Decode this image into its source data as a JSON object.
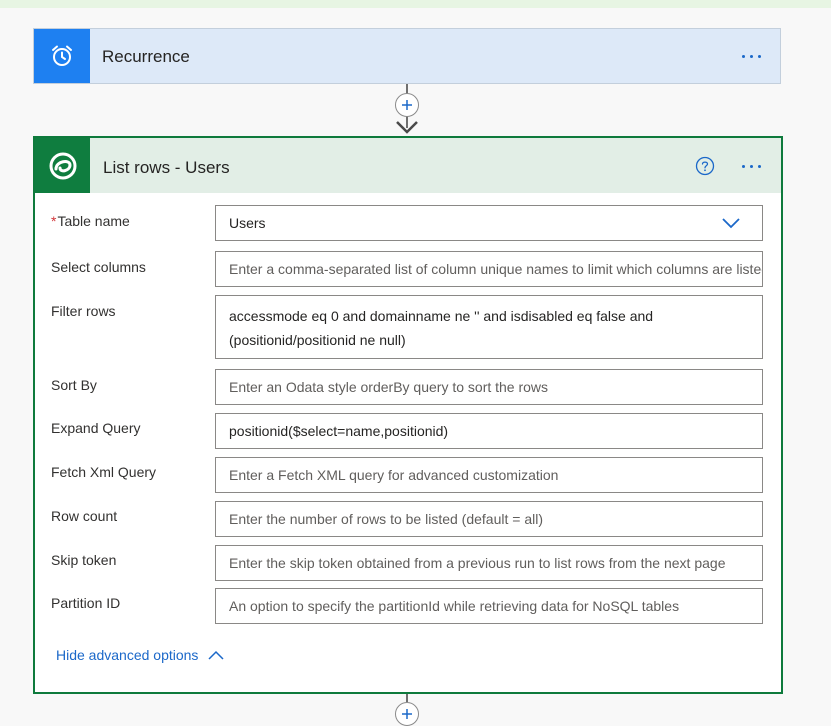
{
  "colors": {
    "recurrence_accent": "#1e80f1",
    "dataverse_accent": "#0f7d3f",
    "link": "#1b68c9",
    "required_star": "#d13438"
  },
  "recurrence": {
    "title": "Recurrence",
    "icon": "alarm-clock-icon",
    "menu_icon": "more-options-icon"
  },
  "connector": {
    "add_icon": "plus-icon",
    "arrow_icon": "arrow-down-icon"
  },
  "list_rows": {
    "title": "List rows - Users",
    "icon": "dataverse-icon",
    "help_icon": "help-icon",
    "menu_icon": "more-options-icon",
    "fields": [
      {
        "label": "Table name",
        "required": "*",
        "value": "Users",
        "placeholder": ""
      },
      {
        "label": "Select columns",
        "value": "",
        "placeholder": "Enter a comma-separated list of column unique names to limit which columns are listed"
      },
      {
        "label": "Filter rows",
        "value": "accessmode eq 0 and domainname ne '' and isdisabled eq false and (positionid/positionid ne null)",
        "placeholder": ""
      },
      {
        "label": "Sort By",
        "value": "",
        "placeholder": "Enter an Odata style orderBy query to sort the rows"
      },
      {
        "label": "Expand Query",
        "value": "positionid($select=name,positionid)",
        "placeholder": ""
      },
      {
        "label": "Fetch Xml Query",
        "value": "",
        "placeholder": "Enter a Fetch XML query for advanced customization"
      },
      {
        "label": "Row count",
        "value": "",
        "placeholder": "Enter the number of rows to be listed (default = all)"
      },
      {
        "label": "Skip token",
        "value": "",
        "placeholder": "Enter the skip token obtained from a previous run to list rows from the next page"
      },
      {
        "label": "Partition ID",
        "value": "",
        "placeholder": "An option to specify the partitionId while retrieving data for NoSQL tables"
      }
    ],
    "hide_advanced": "Hide advanced options"
  }
}
